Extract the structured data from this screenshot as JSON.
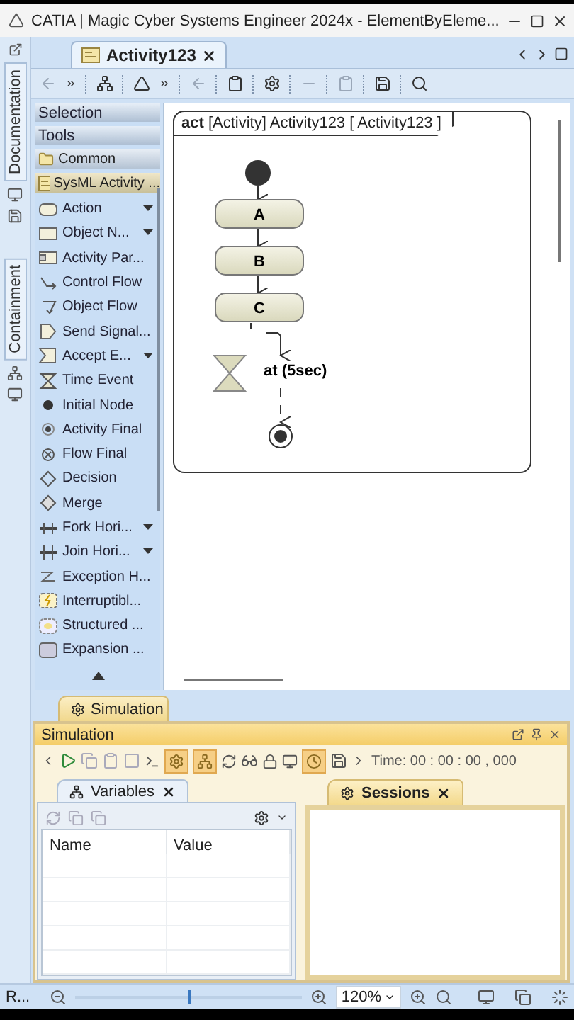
{
  "window": {
    "title": "CATIA | Magic Cyber Systems Engineer 2024x - ElementByEleme..."
  },
  "side_tabs": [
    {
      "label": "Documentation"
    },
    {
      "label": "Containment"
    }
  ],
  "editor_tabs": [
    {
      "label": "Activity123",
      "selected": true
    }
  ],
  "palette": {
    "headers": [
      "Selection",
      "Tools"
    ],
    "groups": [
      {
        "label": "Common",
        "selected": false
      },
      {
        "label": "SysML Activity ...",
        "selected": true
      }
    ],
    "items": [
      {
        "label": "Action",
        "dropdown": true
      },
      {
        "label": "Object N...",
        "dropdown": true
      },
      {
        "label": "Activity Par...",
        "dropdown": false
      },
      {
        "label": "Control Flow",
        "dropdown": false
      },
      {
        "label": "Object Flow",
        "dropdown": false
      },
      {
        "label": "Send Signal...",
        "dropdown": false
      },
      {
        "label": "Accept E...",
        "dropdown": true
      },
      {
        "label": "Time Event",
        "dropdown": false
      },
      {
        "label": "Initial Node",
        "dropdown": false
      },
      {
        "label": "Activity Final",
        "dropdown": false
      },
      {
        "label": "Flow Final",
        "dropdown": false
      },
      {
        "label": "Decision",
        "dropdown": false
      },
      {
        "label": "Merge",
        "dropdown": false
      },
      {
        "label": "Fork Hori...",
        "dropdown": true
      },
      {
        "label": "Join Hori...",
        "dropdown": true
      },
      {
        "label": "Exception H...",
        "dropdown": false
      },
      {
        "label": "Interruptibl...",
        "dropdown": false
      },
      {
        "label": "Structured ...",
        "dropdown": false
      },
      {
        "label": "Expansion ...",
        "dropdown": false
      }
    ]
  },
  "diagram": {
    "frame_title": "**act** [Activity] Activity123 [ Activity123 ]",
    "actions": [
      {
        "label": "A"
      },
      {
        "label": "B"
      },
      {
        "label": "C"
      }
    ],
    "time_event": {
      "label": "at (5sec)"
    }
  },
  "simulation": {
    "tab": "Simulation",
    "title": "Simulation",
    "toggles": [
      {
        "selected": true
      },
      {
        "selected": true
      },
      {
        "selected": true
      }
    ],
    "time": "Time: 00 : 00 : 00 , 000",
    "variables": {
      "tab": "Variables",
      "columns": [
        "Name",
        "Value"
      ]
    },
    "sessions": {
      "tab": "Sessions"
    }
  },
  "status_bar": {
    "label": "R...",
    "zoom": "120%",
    "zoom_slider": {
      "level": 0.5
    }
  }
}
